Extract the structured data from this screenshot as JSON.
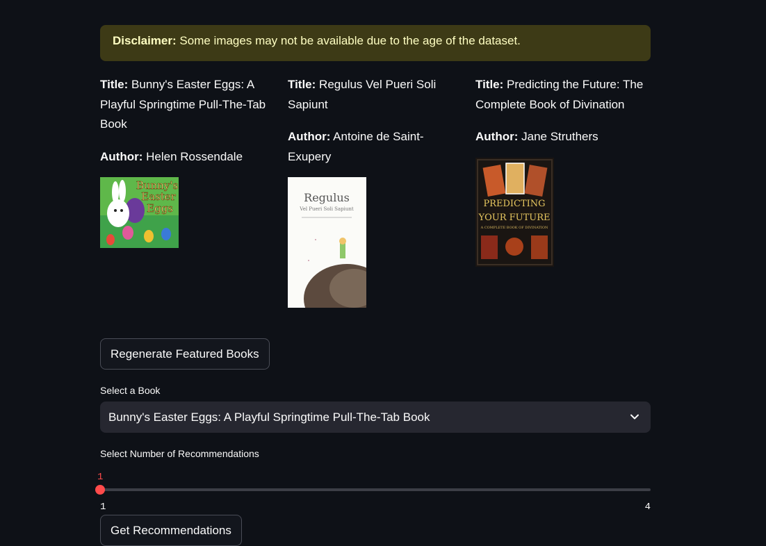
{
  "disclaimer": {
    "label": "Disclaimer:",
    "text": "Some images may not be available due to the age of the dataset."
  },
  "books": [
    {
      "title_label": "Title:",
      "title": "Bunny's Easter Eggs: A Playful Springtime Pull-The-Tab Book",
      "author_label": "Author:",
      "author": "Helen Rossendale",
      "cover_lines": [
        "Bunny's",
        "Easter",
        "Eggs"
      ]
    },
    {
      "title_label": "Title:",
      "title": "Regulus Vel Pueri Soli Sapiunt",
      "author_label": "Author:",
      "author": "Antoine de Saint-Exupery",
      "cover_lines": [
        "Regulus",
        "Vel Pueri Soli Sapiunt"
      ]
    },
    {
      "title_label": "Title:",
      "title": "Predicting the Future: The Complete Book of Divination",
      "author_label": "Author:",
      "author": "Jane Struthers",
      "cover_lines": [
        "PREDICTING",
        "YOUR FUTURE",
        "A COMPLETE BOOK OF DIVINATION"
      ]
    }
  ],
  "regenerate_button": "Regenerate Featured Books",
  "select_book": {
    "label": "Select a Book",
    "value": "Bunny's Easter Eggs: A Playful Springtime Pull-The-Tab Book"
  },
  "recommendations_slider": {
    "label": "Select Number of Recommendations",
    "value": 1,
    "value_text": "1",
    "min": 1,
    "max": 4,
    "min_text": "1",
    "max_text": "4"
  },
  "get_recommendations_button": "Get Recommendations",
  "colors": {
    "background": "#0e1117",
    "disclaimer_bg": "#3d3a16",
    "disclaimer_text": "#ffffc2",
    "accent": "#ff4b4b",
    "select_bg": "#262730"
  },
  "icons": {
    "select_chevron": "chevron-down-icon"
  }
}
